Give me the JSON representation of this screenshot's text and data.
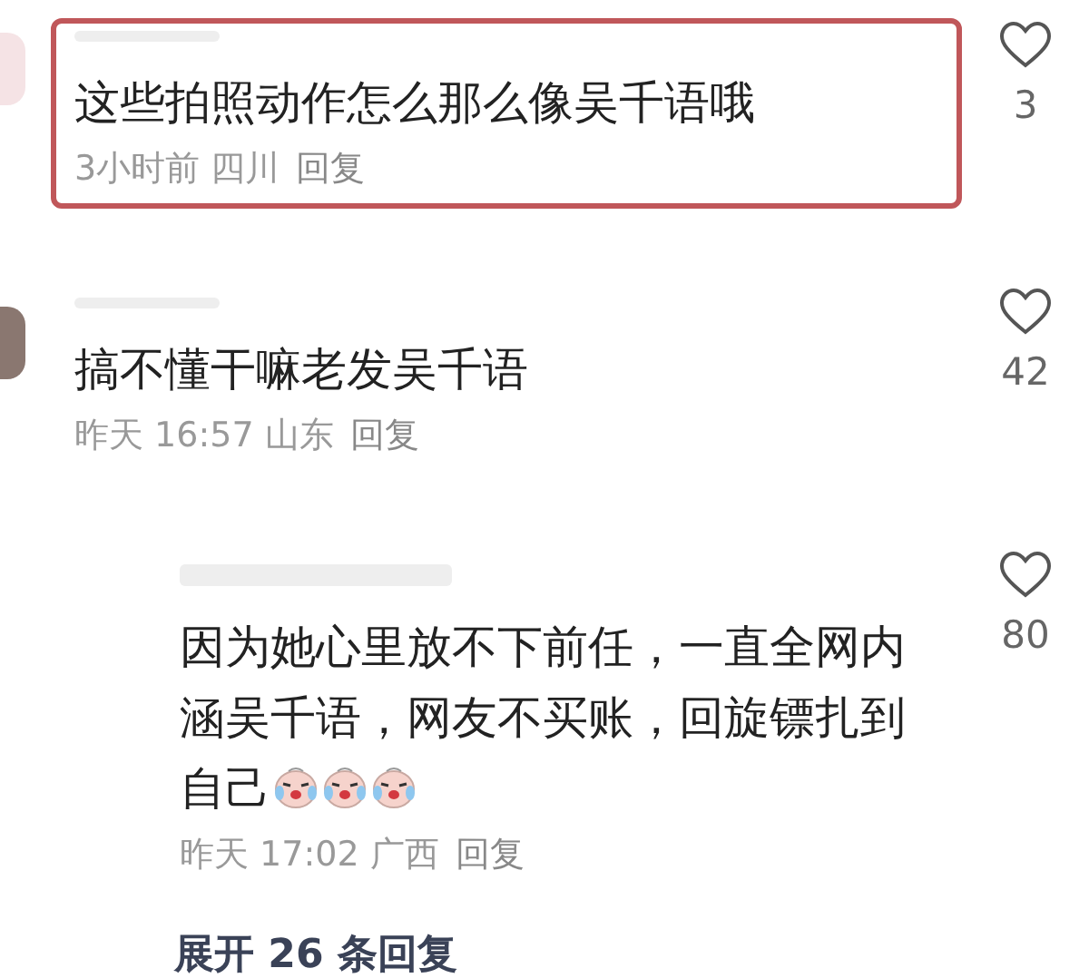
{
  "comments": [
    {
      "text": "这些拍照动作怎么那么像吴千语哦",
      "meta": "3小时前 四川",
      "reply_label": "回复",
      "likes": "3",
      "liked": false,
      "highlighted": true,
      "reply": false
    },
    {
      "text": "搞不懂干嘛老发吴千语",
      "meta": "昨天 16:57 山东",
      "reply_label": "回复",
      "likes": "42",
      "liked": false,
      "highlighted": false,
      "reply": false
    },
    {
      "text": "因为她心里放不下前任，一直全网内涵吴千语，网友不买账，回旋镖扎到自己",
      "emojis": [
        {
          "kind": "crying-laugh"
        },
        {
          "kind": "crying-laugh"
        },
        {
          "kind": "crying-laugh"
        }
      ],
      "meta": "昨天 17:02 广西",
      "reply_label": "回复",
      "likes": "80",
      "liked": false,
      "highlighted": false,
      "reply": true
    }
  ],
  "expand_replies": "展开 26 条回复"
}
